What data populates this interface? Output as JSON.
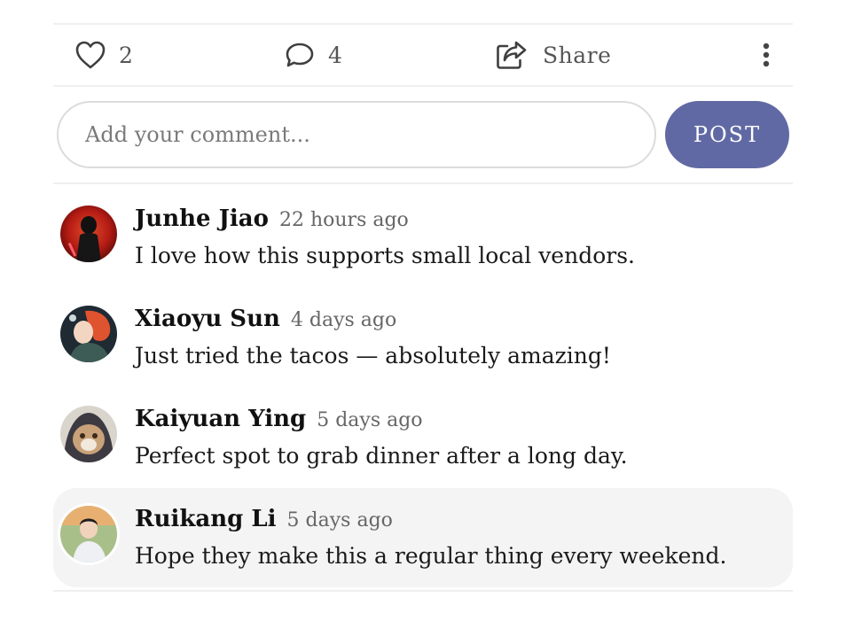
{
  "actions": {
    "likes": "2",
    "comments": "4",
    "share_label": "Share"
  },
  "comment_form": {
    "placeholder": "Add your comment...",
    "post_label": "POST"
  },
  "comments": [
    {
      "author": "Junhe Jiao",
      "time": "22 hours ago",
      "text": "I love how this supports small local vendors."
    },
    {
      "author": "Xiaoyu Sun",
      "time": "4 days ago",
      "text": "Just tried the tacos — absolutely amazing!"
    },
    {
      "author": "Kaiyuan Ying",
      "time": "5 days ago",
      "text": "Perfect spot to grab dinner after a long day."
    },
    {
      "author": "Ruikang Li",
      "time": "5 days ago",
      "text": "Hope they make this a regular thing every weekend."
    }
  ],
  "colors": {
    "accent": "#6169a4",
    "highlight_bg": "#f4f4f4",
    "divider": "#efefef"
  },
  "icons": {
    "like": "heart-icon",
    "comment": "speech-bubble-icon",
    "share": "share-icon",
    "more": "more-vertical-icon"
  }
}
